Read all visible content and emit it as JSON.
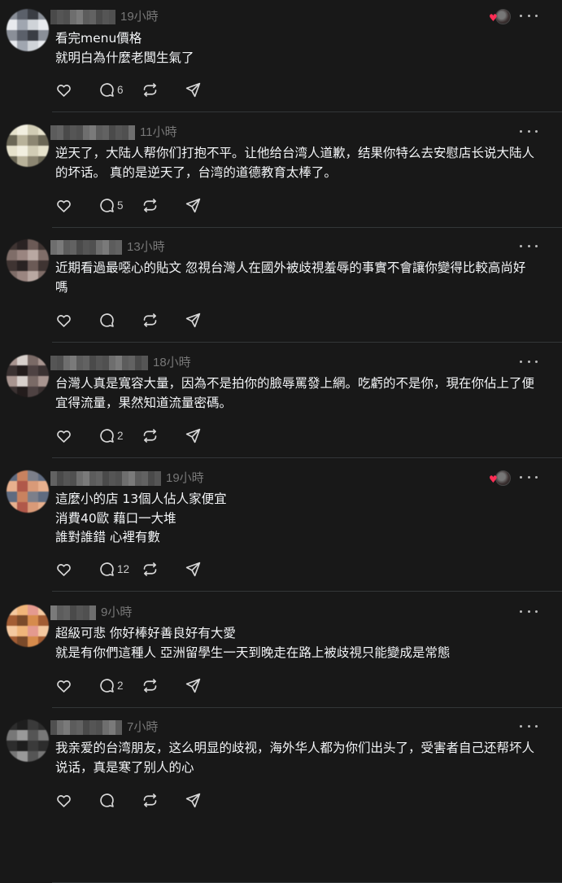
{
  "colors": {
    "background": "#181818",
    "text": "#f3f5f7",
    "muted": "#777777",
    "heart": "#ff2d55",
    "divider": "#333638"
  },
  "icons": {
    "like": "heart-icon",
    "reply": "speech-bubble-icon",
    "repost": "repost-icon",
    "share": "send-icon",
    "more": "more-dots-icon"
  },
  "posts": [
    {
      "time": "19小時",
      "text": "看完menu價格\n就明白為什麼老闆生氣了",
      "replies": "6",
      "liked_by_author": true
    },
    {
      "time": "11小時",
      "text": "逆天了，大陆人帮你们打抱不平。让他给台湾人道歉，结果你特么去安慰店长说大陆人的坏话。 真的是逆天了，台湾的道德教育太棒了。",
      "replies": "5",
      "liked_by_author": false
    },
    {
      "time": "13小時",
      "text": "近期看過最噁心的貼文 忽視台灣人在國外被歧視羞辱的事實不會讓你變得比較高尚好嗎",
      "replies": "",
      "liked_by_author": false
    },
    {
      "time": "18小時",
      "text": "台灣人真是寬容大量，因為不是拍你的臉辱罵發上網。吃虧的不是你，現在你佔上了便宜得流量，果然知道流量密碼。",
      "replies": "2",
      "liked_by_author": false
    },
    {
      "time": "19小時",
      "text": "這麼小的店 13個人佔人家便宜\n消費40歐 藉口一大堆\n誰對誰錯 心裡有數",
      "replies": "12",
      "liked_by_author": true
    },
    {
      "time": "9小時",
      "text": "超級可悲 你好棒好善良好有大愛\n就是有你們這種人 亞洲留學生一天到晚走在路上被歧視只能變成是常態",
      "replies": "2",
      "liked_by_author": false
    },
    {
      "time": "7小時",
      "text": "我亲爱的台湾朋友，这么明显的歧视，海外华人都为你们出头了，受害者自己还帮坏人说话，真是寒了别人的心",
      "replies": "",
      "liked_by_author": false
    }
  ]
}
